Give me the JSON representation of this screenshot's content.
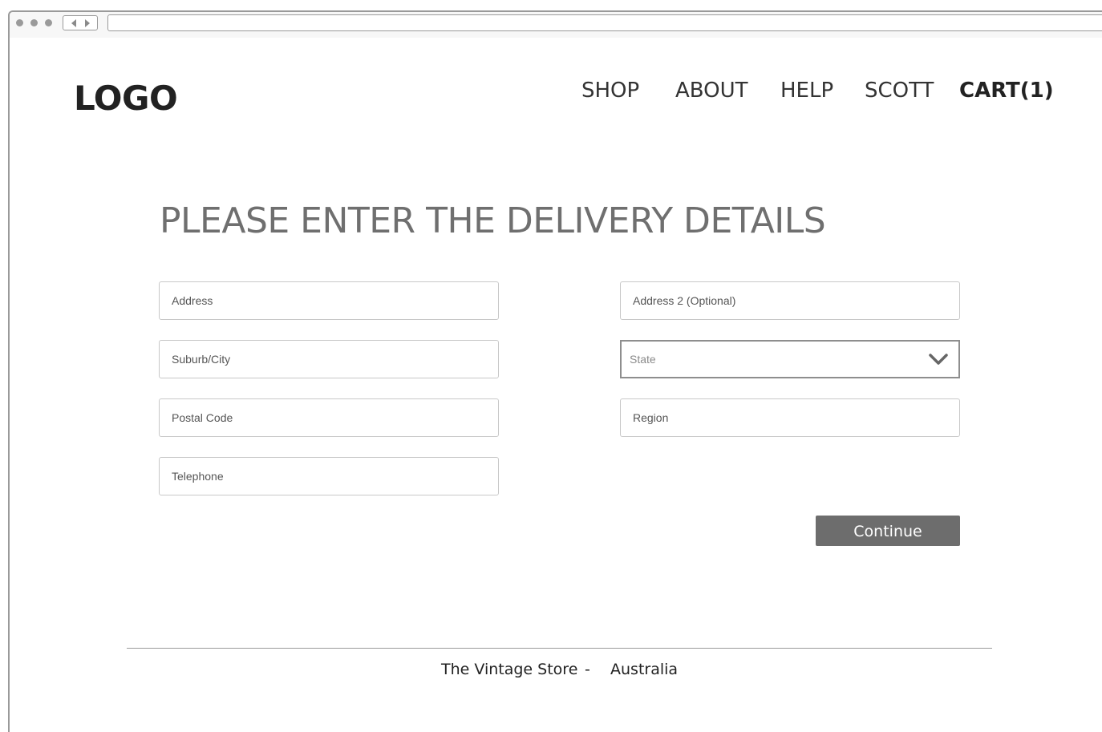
{
  "header": {
    "logo": "LOGO",
    "nav": {
      "shop": "SHOP",
      "about": "ABOUT",
      "help": "HELP",
      "user": "SCOTT",
      "cart": "CART(1)"
    }
  },
  "main": {
    "title": "PLEASE ENTER THE DELIVERY DETAILS",
    "fields": {
      "address": {
        "placeholder": "Address",
        "value": ""
      },
      "address2": {
        "placeholder": "Address 2 (Optional)",
        "value": ""
      },
      "suburb_city": {
        "placeholder": "Suburb/City",
        "value": ""
      },
      "state": {
        "selected": "State",
        "icon": "chevron-down-icon"
      },
      "postal_code": {
        "placeholder": "Postal Code",
        "value": ""
      },
      "region": {
        "placeholder": "Region",
        "value": ""
      },
      "telephone": {
        "placeholder": "Telephone",
        "value": ""
      }
    },
    "continue_label": "Continue"
  },
  "footer": {
    "store": "The Vintage Store",
    "separator": "-",
    "country": "Australia"
  },
  "colors": {
    "button_bg": "#6d6d6d",
    "title_text": "#6f6f6f"
  }
}
